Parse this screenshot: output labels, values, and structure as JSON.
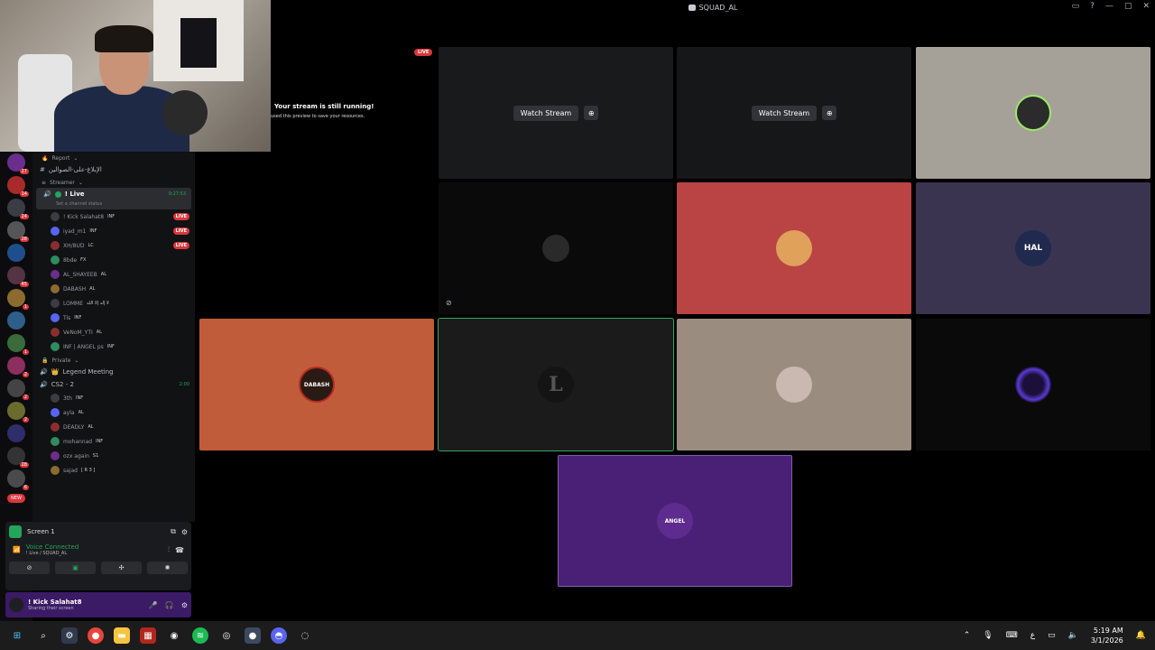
{
  "window": {
    "title": "SQUAD_AL"
  },
  "rail": {
    "servers": [
      {
        "badge": "27"
      },
      {
        "badge": "14"
      },
      {
        "badge": "24"
      },
      {
        "badge": "28"
      },
      {
        "badge": ""
      },
      {
        "badge": "45"
      },
      {
        "badge": "1"
      },
      {
        "badge": ""
      },
      {
        "badge": "1"
      },
      {
        "badge": "2"
      },
      {
        "badge": "2"
      },
      {
        "badge": "2"
      },
      {
        "badge": ""
      },
      {
        "badge": "28"
      },
      {
        "badge": "6"
      }
    ],
    "new_label": "NEW"
  },
  "channels": {
    "report_category": "Report",
    "report_channel": "الإبلاغ-على-الصوالين",
    "streamer_category": "Streamer",
    "live_channel": {
      "name": "! Live",
      "time": "9:27:53",
      "status": "Set a channel status"
    },
    "live_users": [
      {
        "name": "! Kick Salahat8",
        "tag": "INF",
        "live": "LIVE"
      },
      {
        "name": "iyad_m1",
        "tag": "INF",
        "live": "LIVE"
      },
      {
        "name": "XH/8UD",
        "tag": "LC",
        "live": "LIVE"
      },
      {
        "name": "8bde",
        "tag": "FX",
        "live": ""
      },
      {
        "name": "AL_SHAYEEB",
        "tag": "AL",
        "live": ""
      },
      {
        "name": "DABASH",
        "tag": "AL",
        "live": ""
      },
      {
        "name": "LOMME",
        "tag": "لا إله إلا الله",
        "live": ""
      },
      {
        "name": "Tis",
        "tag": "INF",
        "live": ""
      },
      {
        "name": "VeNoM_YTI",
        "tag": "AL",
        "live": ""
      },
      {
        "name": "INF | ANGEL ps",
        "tag": "INF",
        "live": ""
      }
    ],
    "private_category": "Private",
    "legend_channel": "Legend Meeting",
    "cs2_channel": {
      "name": "CS2 - 2",
      "time": "2:00"
    },
    "cs2_users": [
      {
        "name": "3th",
        "tag": "INF"
      },
      {
        "name": "ayla",
        "tag": "AL"
      },
      {
        "name": "DEADLY",
        "tag": "AL"
      },
      {
        "name": "mohannad",
        "tag": "INF"
      },
      {
        "name": "ozx again",
        "tag": "S1"
      },
      {
        "name": "sajad",
        "tag": "[ R 3 ]"
      }
    ]
  },
  "screen_panel": {
    "title": "Screen 1",
    "voice_connected": "Voice Connected",
    "voice_location": "! Live / SQUAD_AL"
  },
  "user_panel": {
    "name": "! Kick Salahat8",
    "status": "Sharing their screen"
  },
  "stage": {
    "live_pill": "LIVE",
    "still_running": "Your stream is still running!",
    "still_sub": "used this preview to save your resources.",
    "watch_label": "Watch Stream",
    "tile_colors": {
      "grey": "#a5a198",
      "red": "#b94443",
      "purple_dark": "#3b3450",
      "orange": "#c15c3b",
      "black": "#0a0a0a",
      "dark": "#1b1b1c",
      "tan": "#9a8d80",
      "purple": "#4a1f76"
    },
    "tile_labels": {
      "dabash": "DABASH",
      "l_letter": "L",
      "angel": "ANGEL",
      "hal": "HAL"
    }
  },
  "taskbar": {
    "time": "5:19 AM",
    "date": "3/1/2026",
    "lang": "ع"
  }
}
